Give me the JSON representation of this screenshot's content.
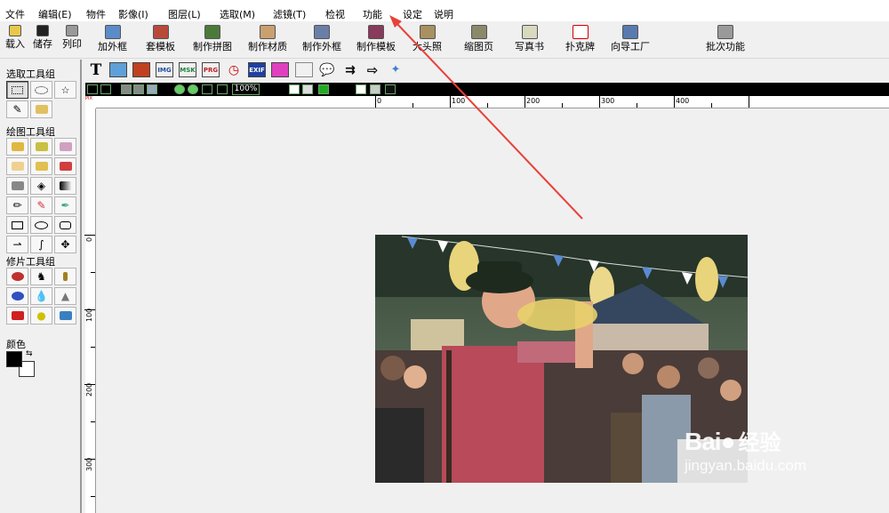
{
  "menu": {
    "items": [
      "文件",
      "编辑(E)",
      "物件",
      "影像(I)",
      "图层(L)",
      "选取(M)",
      "滤镜(T)",
      "检视",
      "功能",
      "设定",
      "说明"
    ]
  },
  "toolbar": {
    "items": [
      {
        "label": "载入",
        "icon": "folder-open-icon"
      },
      {
        "label": "储存",
        "icon": "floppy-disk-icon"
      },
      {
        "label": "列印",
        "icon": "printer-icon"
      },
      {
        "label": "加外框",
        "icon": "frame-icon"
      },
      {
        "label": "套模板",
        "icon": "template-icon"
      },
      {
        "label": "制作拼图",
        "icon": "collage-icon"
      },
      {
        "label": "制作材质",
        "icon": "texture-icon"
      },
      {
        "label": "制作外框",
        "icon": "make-frame-icon"
      },
      {
        "label": "制作模板",
        "icon": "make-template-icon"
      },
      {
        "label": "大头照",
        "icon": "id-photo-icon"
      },
      {
        "label": "缩图页",
        "icon": "thumbnail-page-icon"
      },
      {
        "label": "写真书",
        "icon": "photo-book-icon"
      },
      {
        "label": "扑克牌",
        "icon": "playing-cards-icon"
      },
      {
        "label": "向导工厂",
        "icon": "wizard-factory-icon"
      },
      {
        "label": "批次功能",
        "icon": "batch-icon"
      }
    ]
  },
  "left_panel": {
    "select_group_label": "选取工具组",
    "paint_group_label": "绘图工具组",
    "retouch_group_label": "修片工具组",
    "color_label": "颜色",
    "foreground_color": "#000000",
    "background_color": "#ffffff"
  },
  "object_bar": {
    "text_tool": "T",
    "img_label": "IMG",
    "msk_label": "MSK",
    "prg_label": "PRG",
    "exif_label": "EXIF"
  },
  "view_bar": {
    "zoom": "100%"
  },
  "rulers": {
    "h_labels": [
      "0",
      "100",
      "200",
      "300",
      "400"
    ],
    "v_labels": [
      "0",
      "100",
      "200",
      "300"
    ]
  },
  "watermark": {
    "brand": "Bai",
    "brand_cn": "经验",
    "url": "jingyan.baidu.com"
  },
  "colors": {
    "annotation_arrow": "#e8413a",
    "view_bar_bg": "#000000"
  }
}
